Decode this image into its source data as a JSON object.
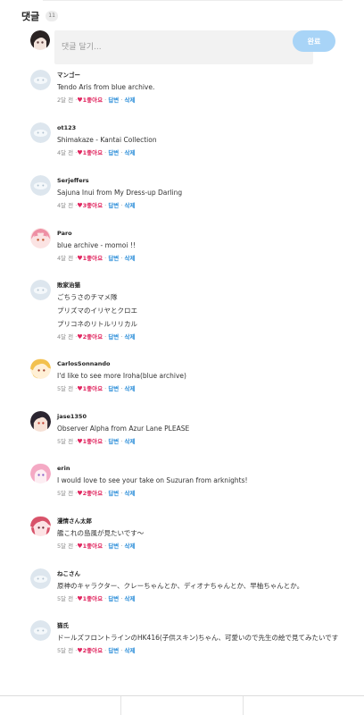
{
  "header": {
    "title": "댓글",
    "count": "11"
  },
  "composer": {
    "placeholder": "댓글 달기...",
    "submit_label": "완료"
  },
  "meta": {
    "separator": "·",
    "like_suffix": "좋아요",
    "reply_label": "답변",
    "delete_label": "삭제"
  },
  "colors": {
    "like": "#e0245e",
    "action": "#2e8fd9",
    "submit": "#a8d4f7",
    "input_bg": "#f2f2f2"
  },
  "comments": [
    {
      "user": "マンゴー",
      "avatar": "default-avatar",
      "lines": [
        "Tendo Aris from blue archive."
      ],
      "time": "2달 전",
      "likes": "1"
    },
    {
      "user": "ot123",
      "avatar": "default-avatar",
      "lines": [
        "Shimakaze - Kantai Collection"
      ],
      "time": "4달 전",
      "likes": "1"
    },
    {
      "user": "Serjeffers",
      "avatar": "default-avatar",
      "lines": [
        "Sajuna Inui from My Dress-up Darling"
      ],
      "time": "4달 전",
      "likes": "3"
    },
    {
      "user": "Paro",
      "avatar": "anime-avatar-pink-hair",
      "lines": [
        "blue archive - momoi !!"
      ],
      "time": "4달 전",
      "likes": "1"
    },
    {
      "user": "敗家治猫",
      "avatar": "default-avatar",
      "lines": [
        "ごちうさのチマメ隊",
        "プリズマのイリヤとクロエ",
        "プリコネのリトルリリカル"
      ],
      "time": "4달 전",
      "likes": "2"
    },
    {
      "user": "CarlosSonnando",
      "avatar": "anime-avatar-blonde",
      "lines": [
        "I'd like to see more Iroha(blue archive)"
      ],
      "time": "5달 전",
      "likes": "1"
    },
    {
      "user": "jase1350",
      "avatar": "anime-avatar-dark-hair",
      "lines": [
        "Observer Alpha from Azur Lane PLEASE"
      ],
      "time": "5달 전",
      "likes": "1"
    },
    {
      "user": "erin",
      "avatar": "anime-avatar-pink",
      "lines": [
        "I would love to see your take on Suzuran from arknights!"
      ],
      "time": "5달 전",
      "likes": "2"
    },
    {
      "user": "漫情さん太郎",
      "avatar": "anime-avatar-red",
      "lines": [
        "艦これの島風が見たいです〜"
      ],
      "time": "5달 전",
      "likes": "1"
    },
    {
      "user": "ねこさん",
      "avatar": "default-avatar",
      "lines": [
        "原神のキャラクター、クレーちゃんとか、ディオナちゃんとか、早柚ちゃんとか。"
      ],
      "time": "5달 전",
      "likes": "1"
    },
    {
      "user": "猫氏",
      "avatar": "default-avatar",
      "lines": [
        "ドールズフロントラインのHK416(子供スキン)ちゃん、可愛いので先生の絵で見てみたいです"
      ],
      "time": "5달 전",
      "likes": "2"
    }
  ]
}
